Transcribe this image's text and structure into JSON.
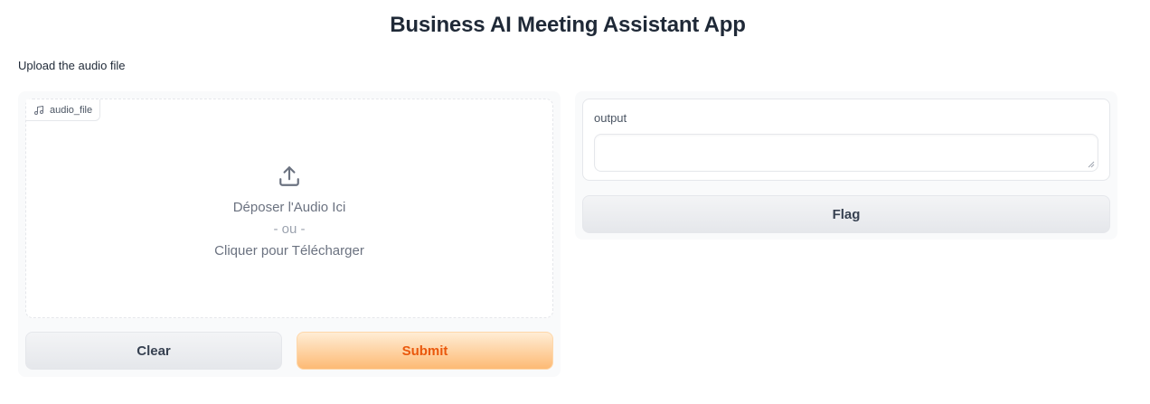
{
  "app": {
    "title": "Business AI Meeting Assistant App",
    "description": "Upload the audio file"
  },
  "input": {
    "label": "audio_file",
    "label_icon": "music-note-icon",
    "upload_icon": "upload-icon",
    "drop_text": "Déposer l'Audio Ici",
    "or_text": "- ou -",
    "click_text": "Cliquer pour Télécharger"
  },
  "actions": {
    "clear_label": "Clear",
    "submit_label": "Submit",
    "flag_label": "Flag"
  },
  "output": {
    "label": "output",
    "value": ""
  },
  "colors": {
    "submit_text": "#ea580c",
    "submit_bg_top": "#ffedd5",
    "submit_bg_bottom": "#fdba74",
    "secondary_bg": "#e5e7eb",
    "panel_bg": "#f9fafb"
  }
}
